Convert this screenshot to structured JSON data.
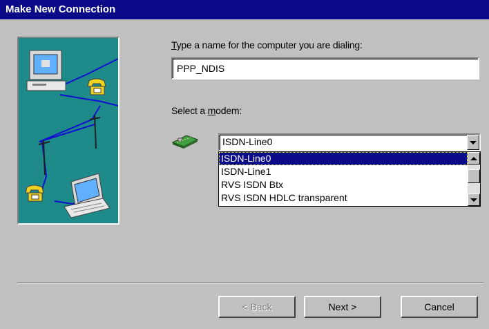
{
  "window": {
    "title": "Make New Connection"
  },
  "name_prompt": {
    "accel": "T",
    "rest": "ype a name for the computer you are dialing:"
  },
  "name_input": {
    "value": "PPP_NDIS"
  },
  "modem_prompt": {
    "before": "Select a ",
    "accel": "m",
    "after": "odem:"
  },
  "modem_combo": {
    "selected": "ISDN-Line0",
    "options": [
      "ISDN-Line0",
      "ISDN-Line1",
      "RVS ISDN Btx",
      "RVS ISDN HDLC transparent"
    ]
  },
  "buttons": {
    "back": "< Back",
    "next": "Next >",
    "cancel": "Cancel"
  },
  "colors": {
    "titlebar": "#0b0b8a",
    "illustration_bg": "#1f8a8a",
    "selection": "#0b0b8a"
  },
  "icons": [
    "computer-icon",
    "telephone-icon",
    "laptop-icon",
    "modem-icon",
    "chevron-down-icon",
    "chevron-up-icon"
  ]
}
